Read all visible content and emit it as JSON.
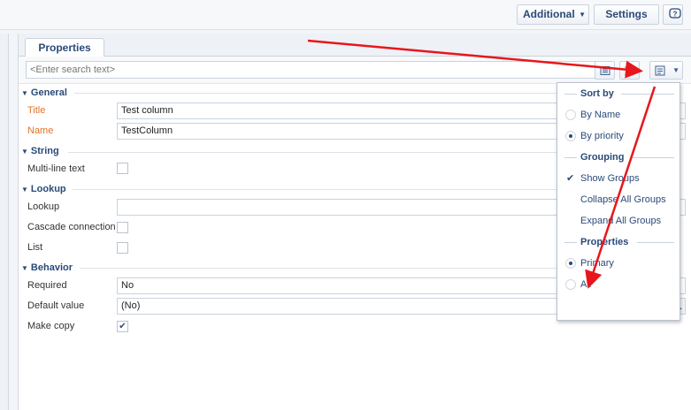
{
  "topbar": {
    "additional_label": "Additional",
    "settings_label": "Settings",
    "help_icon": "help-icon"
  },
  "panel": {
    "tab_label": "Properties",
    "search_placeholder": "<Enter search text>"
  },
  "groups": {
    "general": "General",
    "string": "String",
    "lookup": "Lookup",
    "behavior": "Behavior"
  },
  "fields": {
    "title": {
      "label": "Title",
      "value": "Test column"
    },
    "name": {
      "label": "Name",
      "value": "TestColumn"
    },
    "multiline": {
      "label": "Multi-line text",
      "checked": false
    },
    "lookup": {
      "label": "Lookup",
      "value": ""
    },
    "cascade": {
      "label": "Cascade connection",
      "checked": false
    },
    "list": {
      "label": "List",
      "checked": false
    },
    "required": {
      "label": "Required",
      "value": "No"
    },
    "default_value": {
      "label": "Default value",
      "value": "(No)"
    },
    "make_copy": {
      "label": "Make copy",
      "checked": true
    }
  },
  "menu": {
    "sort_by_header": "Sort by",
    "by_name": "By Name",
    "by_priority": "By priority",
    "grouping_header": "Grouping",
    "show_groups": "Show Groups",
    "collapse_all": "Collapse All Groups",
    "expand_all": "Expand All Groups",
    "properties_header": "Properties",
    "primary": "Primary",
    "all": "All",
    "sort_selected": "By priority",
    "properties_selected": "Primary"
  },
  "colors": {
    "accent": "#2a4a78",
    "required_label": "#e27327",
    "annotation_arrow": "#e8161b"
  }
}
